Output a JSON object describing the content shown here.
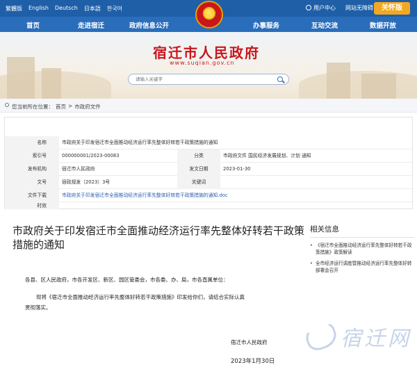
{
  "top_bar": {
    "languages": [
      "繁體版",
      "English",
      "Deutsch",
      "日本語",
      "한국어"
    ],
    "user_center": "用户中心",
    "accessibility": "网站无障碍",
    "care_mode": "关怀版"
  },
  "nav": {
    "items": [
      "首页",
      "走进宿迁",
      "政府信息公开",
      "办事服务",
      "互动交流",
      "数据开放"
    ]
  },
  "banner": {
    "site_name": "宿迁市人民政府",
    "site_url": "www.suqian.gov.cn",
    "search_placeholder": "请输入关键字"
  },
  "breadcrumb": {
    "prefix": "您当前所在位置：",
    "items": [
      "首页",
      ">",
      "市政府文件"
    ]
  },
  "info_table": {
    "name_label": "名称",
    "name_value": "市政府关于印发宿迁市全面推动经济运行率先整体好转若干政策措施的通知",
    "index_label": "索引号",
    "index_value": "000000001/2023-00083",
    "category_label": "分类",
    "category_value": "市政府文件   国民经济发展规划、计划    通知",
    "issuer_label": "发布机构",
    "issuer_value": "宿迁市人民政府",
    "date_label": "发文日期",
    "date_value": "2023-01-30",
    "docno_label": "文号",
    "docno_value": "宿政规发〔2023〕3号",
    "keywords_label": "关键词",
    "keywords_value": "",
    "download_label": "文件下载",
    "download_value": "市政府关于印发宿迁市全面推动经济运行率先整体好转若干政策措施的通知.doc",
    "validity_label": "时效",
    "validity_value": ""
  },
  "article": {
    "title": "市政府关于印发宿迁市全面推动经济运行率先整体好转若干政策措施的通知",
    "salutation": "各县、区人民政府，市各开发区、新区、园区管委会，市各委、办、局，市各直属单位：",
    "body_line1": "现将《宿迁市全面推动经济运行率先整体好转若干政策措施》印发给你们，请结合实际认真",
    "body_line2": "贯彻落实。",
    "signer": "宿迁市人民政府",
    "sign_date": "2023年1月30日"
  },
  "related": {
    "heading": "相关信息",
    "items": [
      "《宿迁市全面推动经济运行率先整体好转若干政策措施》政策解读",
      "全市经济运行调度暨推动经济运行率先整体好转部署会召开"
    ]
  },
  "watermark": {
    "text": "宿迁网"
  },
  "colors": {
    "top_bar": "#1f5fa8",
    "nav": "#2a6dbb",
    "brand_red": "#c8161d",
    "care_button": "#f3a823",
    "link": "#2a5db0"
  }
}
